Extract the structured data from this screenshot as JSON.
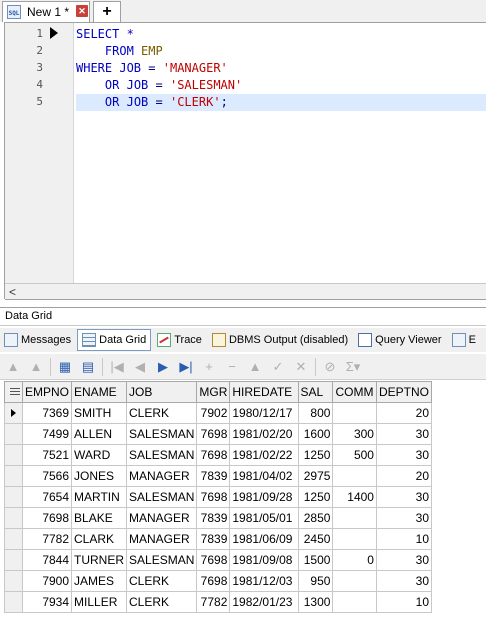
{
  "tab": {
    "title": "New 1 *",
    "new_tab_label": "+"
  },
  "editor": {
    "lines": [
      {
        "n": "1"
      },
      {
        "n": "2"
      },
      {
        "n": "3"
      },
      {
        "n": "4"
      },
      {
        "n": "5"
      }
    ],
    "code": {
      "l1": {
        "kw": "SELECT",
        "rest": " *"
      },
      "l2": {
        "kw": "FROM",
        "id": "EMP"
      },
      "l3": {
        "kw": "WHERE",
        "id": "JOB",
        "op": "=",
        "str": "'MANAGER'"
      },
      "l4": {
        "kw": "OR",
        "id": "JOB",
        "op": "=",
        "str": "'SALESMAN'"
      },
      "l5": {
        "kw": "OR",
        "id": "JOB",
        "op": "=",
        "str": "'CLERK'",
        "end": ";"
      }
    }
  },
  "panel": {
    "title": "Data Grid"
  },
  "subtabs": {
    "messages": "Messages",
    "data_grid": "Data Grid",
    "trace": "Trace",
    "dbms": "DBMS Output (disabled)",
    "query_viewer": "Query Viewer",
    "more": "E"
  },
  "grid": {
    "columns": [
      "EMPNO",
      "ENAME",
      "JOB",
      "MGR",
      "HIREDATE",
      "SAL",
      "COMM",
      "DEPTNO"
    ],
    "rows": [
      [
        "7369",
        "SMITH",
        "CLERK",
        "7902",
        "1980/12/17",
        "800",
        "",
        "20"
      ],
      [
        "7499",
        "ALLEN",
        "SALESMAN",
        "7698",
        "1981/02/20",
        "1600",
        "300",
        "30"
      ],
      [
        "7521",
        "WARD",
        "SALESMAN",
        "7698",
        "1981/02/22",
        "1250",
        "500",
        "30"
      ],
      [
        "7566",
        "JONES",
        "MANAGER",
        "7839",
        "1981/04/02",
        "2975",
        "",
        "20"
      ],
      [
        "7654",
        "MARTIN",
        "SALESMAN",
        "7698",
        "1981/09/28",
        "1250",
        "1400",
        "30"
      ],
      [
        "7698",
        "BLAKE",
        "MANAGER",
        "7839",
        "1981/05/01",
        "2850",
        "",
        "30"
      ],
      [
        "7782",
        "CLARK",
        "MANAGER",
        "7839",
        "1981/06/09",
        "2450",
        "",
        "10"
      ],
      [
        "7844",
        "TURNER",
        "SALESMAN",
        "7698",
        "1981/09/08",
        "1500",
        "0",
        "30"
      ],
      [
        "7900",
        "JAMES",
        "CLERK",
        "7698",
        "1981/12/03",
        "950",
        "",
        "30"
      ],
      [
        "7934",
        "MILLER",
        "CLERK",
        "7782",
        "1982/01/23",
        "1300",
        "",
        "10"
      ]
    ]
  }
}
